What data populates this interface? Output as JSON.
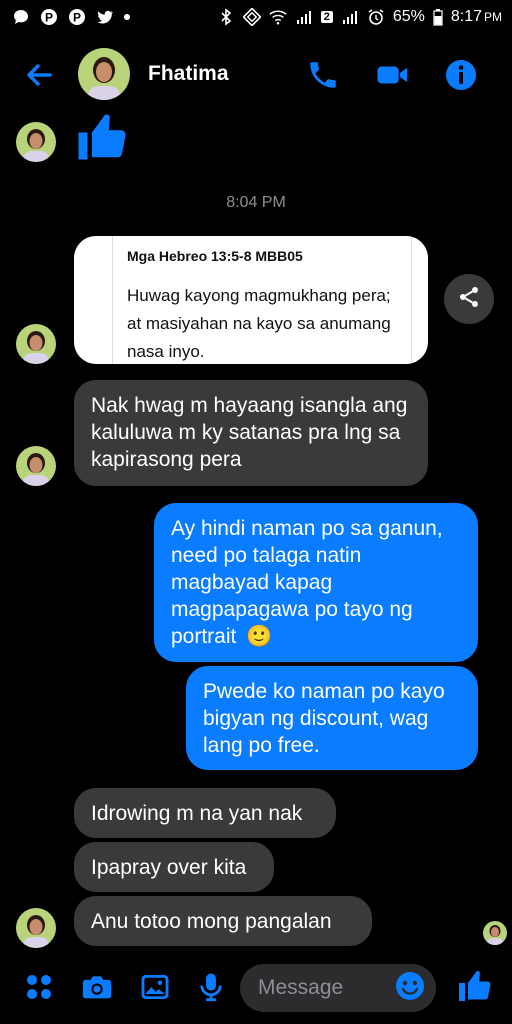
{
  "status_bar": {
    "battery": "65%",
    "time": "8:17",
    "ampm": "PM",
    "sim": "2"
  },
  "header": {
    "contact_name": "Fhatima"
  },
  "chat": {
    "timestamp": "8:04 PM",
    "verse_card": {
      "reference": "Mga Hebreo 13:5-8 MBB05",
      "text": "Huwag kayong magmukhang pera; at masiyahan na kayo sa anumang nasa inyo."
    },
    "messages": [
      {
        "from": "them",
        "text": "Nak hwag m hayaang isangla ang kaluluwa m ky satanas pra lng sa kapirasong pera"
      },
      {
        "from": "me",
        "text": "Ay hindi naman po sa ganun, need po talaga natin magbayad kapag magpapagawa po tayo ng portrait",
        "emoji": "🙂"
      },
      {
        "from": "me",
        "text": "Pwede ko naman po kayo bigyan ng discount, wag lang po free."
      },
      {
        "from": "them",
        "text": "Idrowing m na yan nak"
      },
      {
        "from": "them",
        "text": "Ipapray over kita"
      },
      {
        "from": "them",
        "text": "Anu totoo mong pangalan"
      }
    ]
  },
  "composer": {
    "placeholder": "Message"
  },
  "colors": {
    "accent": "#0a7cff",
    "incoming_bubble": "#3a3a3c",
    "background": "#000000"
  }
}
